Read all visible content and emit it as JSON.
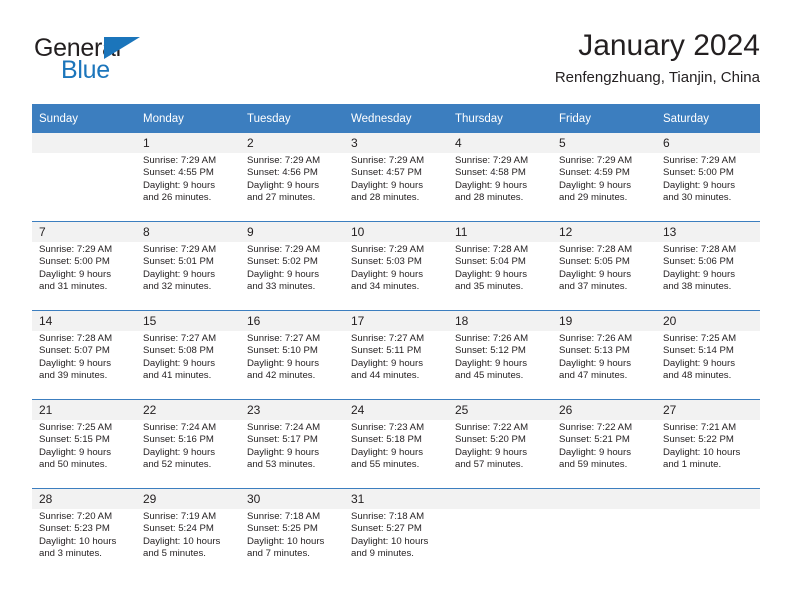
{
  "brand": {
    "name_part1": "General",
    "name_part2": "Blue"
  },
  "header": {
    "title": "January 2024",
    "subtitle": "Renfengzhuang, Tianjin, China"
  },
  "colors": {
    "header_blue": "#3c7ebf",
    "logo_blue": "#1b75bb",
    "daynum_band": "#f2f2f2",
    "text": "#231f20"
  },
  "weekdays": [
    "Sunday",
    "Monday",
    "Tuesday",
    "Wednesday",
    "Thursday",
    "Friday",
    "Saturday"
  ],
  "weeks": [
    {
      "days": [
        {
          "num": "",
          "sunrise": "",
          "sunset": "",
          "daylight1": "",
          "daylight2": ""
        },
        {
          "num": "1",
          "sunrise": "Sunrise: 7:29 AM",
          "sunset": "Sunset: 4:55 PM",
          "daylight1": "Daylight: 9 hours",
          "daylight2": "and 26 minutes."
        },
        {
          "num": "2",
          "sunrise": "Sunrise: 7:29 AM",
          "sunset": "Sunset: 4:56 PM",
          "daylight1": "Daylight: 9 hours",
          "daylight2": "and 27 minutes."
        },
        {
          "num": "3",
          "sunrise": "Sunrise: 7:29 AM",
          "sunset": "Sunset: 4:57 PM",
          "daylight1": "Daylight: 9 hours",
          "daylight2": "and 28 minutes."
        },
        {
          "num": "4",
          "sunrise": "Sunrise: 7:29 AM",
          "sunset": "Sunset: 4:58 PM",
          "daylight1": "Daylight: 9 hours",
          "daylight2": "and 28 minutes."
        },
        {
          "num": "5",
          "sunrise": "Sunrise: 7:29 AM",
          "sunset": "Sunset: 4:59 PM",
          "daylight1": "Daylight: 9 hours",
          "daylight2": "and 29 minutes."
        },
        {
          "num": "6",
          "sunrise": "Sunrise: 7:29 AM",
          "sunset": "Sunset: 5:00 PM",
          "daylight1": "Daylight: 9 hours",
          "daylight2": "and 30 minutes."
        }
      ]
    },
    {
      "days": [
        {
          "num": "7",
          "sunrise": "Sunrise: 7:29 AM",
          "sunset": "Sunset: 5:00 PM",
          "daylight1": "Daylight: 9 hours",
          "daylight2": "and 31 minutes."
        },
        {
          "num": "8",
          "sunrise": "Sunrise: 7:29 AM",
          "sunset": "Sunset: 5:01 PM",
          "daylight1": "Daylight: 9 hours",
          "daylight2": "and 32 minutes."
        },
        {
          "num": "9",
          "sunrise": "Sunrise: 7:29 AM",
          "sunset": "Sunset: 5:02 PM",
          "daylight1": "Daylight: 9 hours",
          "daylight2": "and 33 minutes."
        },
        {
          "num": "10",
          "sunrise": "Sunrise: 7:29 AM",
          "sunset": "Sunset: 5:03 PM",
          "daylight1": "Daylight: 9 hours",
          "daylight2": "and 34 minutes."
        },
        {
          "num": "11",
          "sunrise": "Sunrise: 7:28 AM",
          "sunset": "Sunset: 5:04 PM",
          "daylight1": "Daylight: 9 hours",
          "daylight2": "and 35 minutes."
        },
        {
          "num": "12",
          "sunrise": "Sunrise: 7:28 AM",
          "sunset": "Sunset: 5:05 PM",
          "daylight1": "Daylight: 9 hours",
          "daylight2": "and 37 minutes."
        },
        {
          "num": "13",
          "sunrise": "Sunrise: 7:28 AM",
          "sunset": "Sunset: 5:06 PM",
          "daylight1": "Daylight: 9 hours",
          "daylight2": "and 38 minutes."
        }
      ]
    },
    {
      "days": [
        {
          "num": "14",
          "sunrise": "Sunrise: 7:28 AM",
          "sunset": "Sunset: 5:07 PM",
          "daylight1": "Daylight: 9 hours",
          "daylight2": "and 39 minutes."
        },
        {
          "num": "15",
          "sunrise": "Sunrise: 7:27 AM",
          "sunset": "Sunset: 5:08 PM",
          "daylight1": "Daylight: 9 hours",
          "daylight2": "and 41 minutes."
        },
        {
          "num": "16",
          "sunrise": "Sunrise: 7:27 AM",
          "sunset": "Sunset: 5:10 PM",
          "daylight1": "Daylight: 9 hours",
          "daylight2": "and 42 minutes."
        },
        {
          "num": "17",
          "sunrise": "Sunrise: 7:27 AM",
          "sunset": "Sunset: 5:11 PM",
          "daylight1": "Daylight: 9 hours",
          "daylight2": "and 44 minutes."
        },
        {
          "num": "18",
          "sunrise": "Sunrise: 7:26 AM",
          "sunset": "Sunset: 5:12 PM",
          "daylight1": "Daylight: 9 hours",
          "daylight2": "and 45 minutes."
        },
        {
          "num": "19",
          "sunrise": "Sunrise: 7:26 AM",
          "sunset": "Sunset: 5:13 PM",
          "daylight1": "Daylight: 9 hours",
          "daylight2": "and 47 minutes."
        },
        {
          "num": "20",
          "sunrise": "Sunrise: 7:25 AM",
          "sunset": "Sunset: 5:14 PM",
          "daylight1": "Daylight: 9 hours",
          "daylight2": "and 48 minutes."
        }
      ]
    },
    {
      "days": [
        {
          "num": "21",
          "sunrise": "Sunrise: 7:25 AM",
          "sunset": "Sunset: 5:15 PM",
          "daylight1": "Daylight: 9 hours",
          "daylight2": "and 50 minutes."
        },
        {
          "num": "22",
          "sunrise": "Sunrise: 7:24 AM",
          "sunset": "Sunset: 5:16 PM",
          "daylight1": "Daylight: 9 hours",
          "daylight2": "and 52 minutes."
        },
        {
          "num": "23",
          "sunrise": "Sunrise: 7:24 AM",
          "sunset": "Sunset: 5:17 PM",
          "daylight1": "Daylight: 9 hours",
          "daylight2": "and 53 minutes."
        },
        {
          "num": "24",
          "sunrise": "Sunrise: 7:23 AM",
          "sunset": "Sunset: 5:18 PM",
          "daylight1": "Daylight: 9 hours",
          "daylight2": "and 55 minutes."
        },
        {
          "num": "25",
          "sunrise": "Sunrise: 7:22 AM",
          "sunset": "Sunset: 5:20 PM",
          "daylight1": "Daylight: 9 hours",
          "daylight2": "and 57 minutes."
        },
        {
          "num": "26",
          "sunrise": "Sunrise: 7:22 AM",
          "sunset": "Sunset: 5:21 PM",
          "daylight1": "Daylight: 9 hours",
          "daylight2": "and 59 minutes."
        },
        {
          "num": "27",
          "sunrise": "Sunrise: 7:21 AM",
          "sunset": "Sunset: 5:22 PM",
          "daylight1": "Daylight: 10 hours",
          "daylight2": "and 1 minute."
        }
      ]
    },
    {
      "days": [
        {
          "num": "28",
          "sunrise": "Sunrise: 7:20 AM",
          "sunset": "Sunset: 5:23 PM",
          "daylight1": "Daylight: 10 hours",
          "daylight2": "and 3 minutes."
        },
        {
          "num": "29",
          "sunrise": "Sunrise: 7:19 AM",
          "sunset": "Sunset: 5:24 PM",
          "daylight1": "Daylight: 10 hours",
          "daylight2": "and 5 minutes."
        },
        {
          "num": "30",
          "sunrise": "Sunrise: 7:18 AM",
          "sunset": "Sunset: 5:25 PM",
          "daylight1": "Daylight: 10 hours",
          "daylight2": "and 7 minutes."
        },
        {
          "num": "31",
          "sunrise": "Sunrise: 7:18 AM",
          "sunset": "Sunset: 5:27 PM",
          "daylight1": "Daylight: 10 hours",
          "daylight2": "and 9 minutes."
        },
        {
          "num": "",
          "sunrise": "",
          "sunset": "",
          "daylight1": "",
          "daylight2": ""
        },
        {
          "num": "",
          "sunrise": "",
          "sunset": "",
          "daylight1": "",
          "daylight2": ""
        },
        {
          "num": "",
          "sunrise": "",
          "sunset": "",
          "daylight1": "",
          "daylight2": ""
        }
      ]
    }
  ]
}
